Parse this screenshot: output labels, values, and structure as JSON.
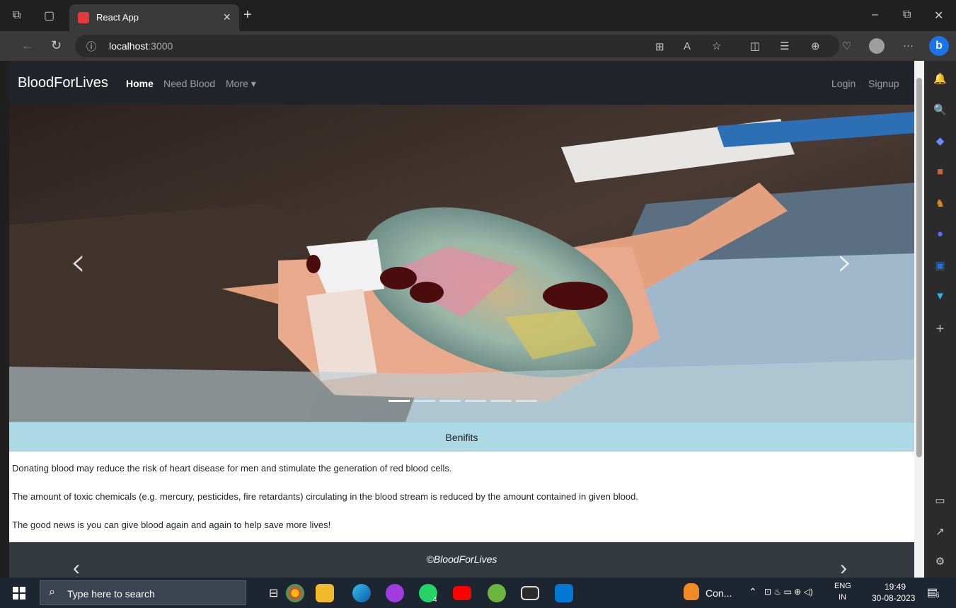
{
  "browser": {
    "tab_title": "React App",
    "tab_close": "×",
    "new_tab": "+",
    "url_host": "localhost",
    "url_port": ":3000",
    "window_minimize": "–",
    "window_restore": "⧉",
    "window_close": "✕"
  },
  "navbar": {
    "brand": "BloodForLives",
    "links": [
      "Home",
      "Need Blood",
      "More ▾"
    ],
    "right_links": [
      "Login",
      "Signup"
    ]
  },
  "carousel": {
    "prev": "‹",
    "next": "›",
    "indicator_count": 6,
    "active_index": 0
  },
  "benefits": {
    "title": "Benifits",
    "items": [
      "Donating blood may reduce the risk of heart disease for men and stimulate the generation of red blood cells.",
      "The amount of toxic chemicals (e.g. mercury, pesticides, fire retardants) circulating in the blood stream is reduced by the amount contained in given blood.",
      "The good news is you can give blood again and again to help save more lives!"
    ]
  },
  "footer": {
    "text": "©BloodForLives",
    "prev": "‹",
    "next": "›"
  },
  "taskbar": {
    "search_placeholder": "Type here to search",
    "task_label": "Con...",
    "language": "ENG",
    "region": "IN",
    "time": "19:49",
    "date": "30-08-2023",
    "notification_count": "6",
    "whatsapp_badge": "4"
  },
  "colors": {
    "navbar_bg": "#212529",
    "benefits_header_bg": "#add8e6",
    "footer_bg": "#343a40",
    "taskbar_bg": "#1c2530"
  }
}
